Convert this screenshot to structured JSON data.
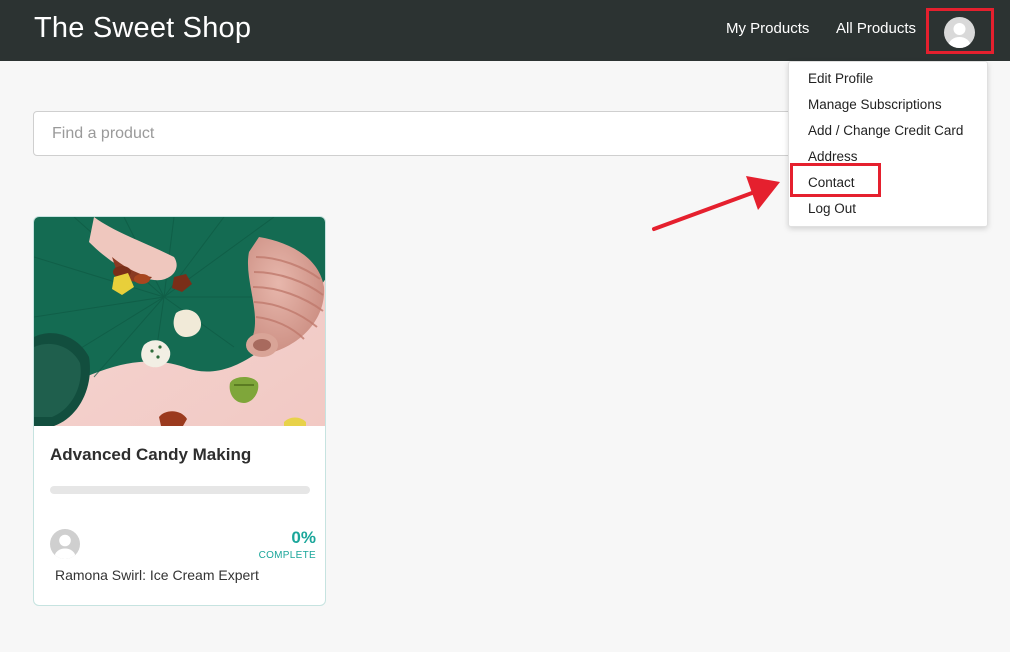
{
  "header": {
    "brand": "The Sweet Shop",
    "nav": {
      "my_products": "My Products",
      "all_products": "All Products"
    },
    "avatar_icon": "user-avatar-icon",
    "background": "#2c3332"
  },
  "search": {
    "placeholder": "Find a product",
    "value": ""
  },
  "dropdown": {
    "items": [
      {
        "label": "Edit Profile"
      },
      {
        "label": "Manage Subscriptions"
      },
      {
        "label": "Add / Change Credit Card"
      },
      {
        "label": "Address"
      },
      {
        "label": "Contact"
      },
      {
        "label": "Log Out"
      }
    ],
    "highlighted_item": "Contact"
  },
  "annotation": {
    "color": "#e5202e"
  },
  "products": [
    {
      "title": "Advanced Candy Making",
      "progress_percent": 0,
      "progress_label": "0%",
      "complete_label": "COMPLETE",
      "author": "Ramona Swirl: Ice Cream Expert",
      "accent": "#1aa69a"
    }
  ]
}
